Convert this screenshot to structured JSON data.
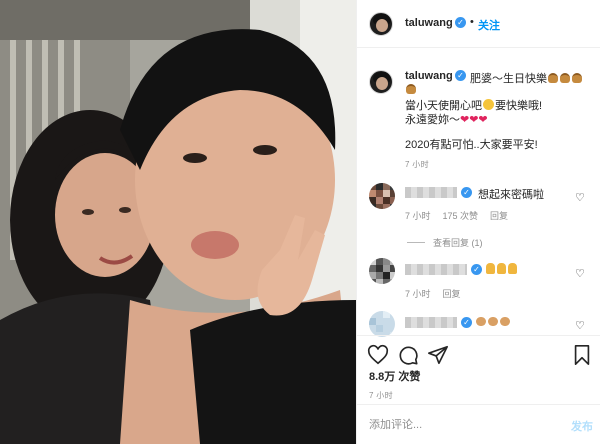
{
  "post": {
    "username": "taluwang",
    "follow_label": "关注",
    "dot": "•",
    "caption": {
      "line1": "肥婆～生日快樂",
      "line1b": "",
      "line2": "當小天使開心吧",
      "line2_end": "要快樂哦!",
      "line3": "永遠愛妳～",
      "line4": "2020有點可怕..大家要平安!",
      "time": "7 小时"
    },
    "comments": [
      {
        "text": "想起來密碼啦",
        "likes": "175 次赞",
        "reply": "回复",
        "time": "7 小时",
        "view_replies": "查看回复 (1)"
      },
      {
        "text": "",
        "time": "7 小时",
        "reply": "回复"
      },
      {
        "text": ""
      }
    ],
    "likes_text": "8.8万 次赞",
    "post_time": "7 小时",
    "comment_placeholder": "添加评论...",
    "post_button": "发布",
    "colors": {
      "accent": "#0095f6",
      "heart": "#e0245e",
      "verified": "#3897f0"
    },
    "icons": [
      "verified-badge-icon",
      "heart-icon",
      "comment-icon",
      "share-icon",
      "bookmark-icon",
      "burger-emoji",
      "pray-emoji",
      "muscle-emoji"
    ]
  }
}
